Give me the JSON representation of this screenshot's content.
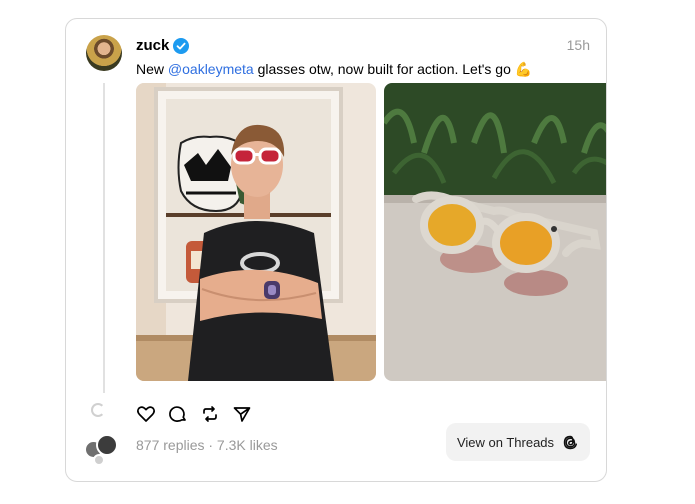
{
  "post": {
    "username": "zuck",
    "time": "15h",
    "caption_prefix": "New ",
    "mention": "@oakleymeta",
    "caption_suffix": " glasses otw, now built for action. Let's go",
    "emoji": "💪",
    "replies_likes": "877 replies · 7.3K likes",
    "view_on_threads": "View on Threads"
  },
  "icons": [
    "verified-badge-icon",
    "heart-icon",
    "comment-icon",
    "repost-icon",
    "share-icon",
    "threads-logo-icon"
  ],
  "colors": {
    "mention": "#2f6fe0",
    "verified": "#1d9bf0",
    "muted": "#999999"
  }
}
